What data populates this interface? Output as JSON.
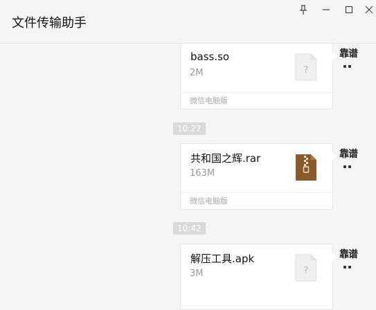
{
  "window": {
    "title": "文件传输助手",
    "controls": {
      "pin_icon": "pin-icon",
      "minimize_icon": "minimize-icon",
      "maximize_icon": "maximize-icon",
      "close_icon": "close-icon"
    }
  },
  "messages": [
    {
      "file_name": "bass.so",
      "size": "2M",
      "source": "微信电脑版",
      "icon": "unknown-file-icon"
    },
    {
      "timestamp": "10:27",
      "file_name": "共和国之辉.rar",
      "size": "163M",
      "source": "微信电脑版",
      "icon": "archive-file-icon"
    },
    {
      "timestamp": "10:42",
      "file_name": "解压工具.apk",
      "size": "3M",
      "icon": "unknown-file-icon"
    }
  ],
  "avatar": {
    "text": "靠谱"
  },
  "colors": {
    "background": "#f5f5f5",
    "card": "#ffffff",
    "timestamp_badge": "#dadada",
    "archive_icon": "#8b5a2b"
  }
}
